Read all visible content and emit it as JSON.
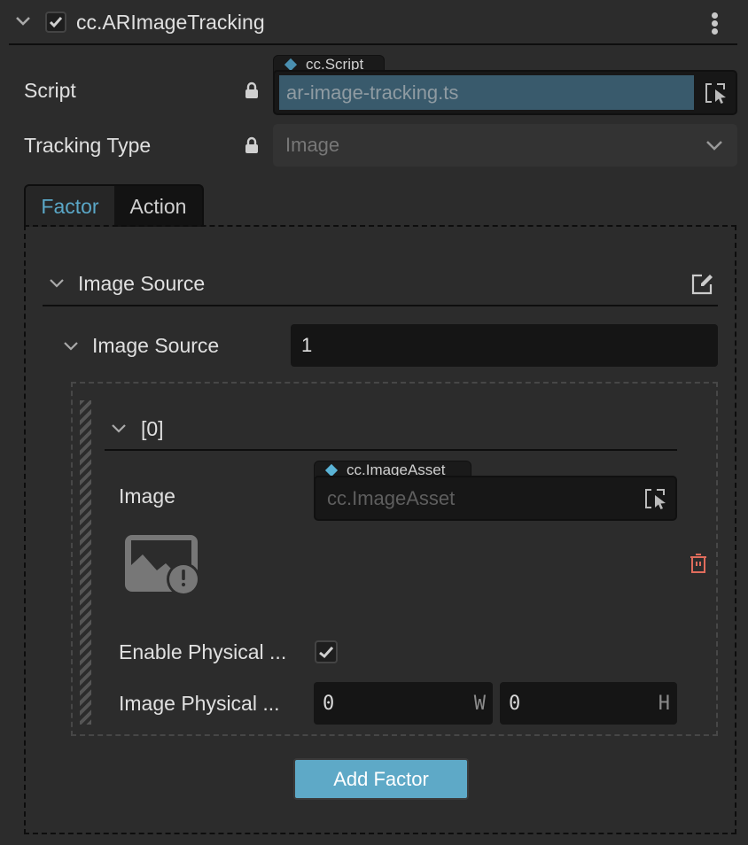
{
  "component": {
    "title": "cc.ARImageTracking",
    "enabled": true,
    "menu_icon": "kebab-menu-icon"
  },
  "properties": {
    "script": {
      "label": "Script",
      "locked": true,
      "asset_type": "cc.Script",
      "value": "ar-image-tracking.ts"
    },
    "tracking_type": {
      "label": "Tracking Type",
      "locked": true,
      "value": "Image"
    }
  },
  "tabs": [
    {
      "label": "Factor",
      "active": true
    },
    {
      "label": "Action",
      "active": false
    }
  ],
  "factor": {
    "section_title": "Image Source",
    "array": {
      "label": "Image Source",
      "count": "1",
      "items": [
        {
          "index_label": "[0]",
          "image": {
            "label": "Image",
            "asset_type": "cc.ImageAsset",
            "placeholder": "cc.ImageAsset"
          },
          "enable_physical_size": {
            "label": "Enable Physical ...",
            "checked": true
          },
          "image_physical_size": {
            "label": "Image Physical ...",
            "width": "0",
            "width_axis": "W",
            "height": "0",
            "height_axis": "H"
          }
        }
      ]
    },
    "add_button": "Add Factor"
  },
  "colors": {
    "accent": "#5ea9c7",
    "active_tab": "#5aa7c7",
    "delete": "#e06c5c",
    "script_highlight": "#395a6c",
    "background": "#2c2c2c"
  }
}
